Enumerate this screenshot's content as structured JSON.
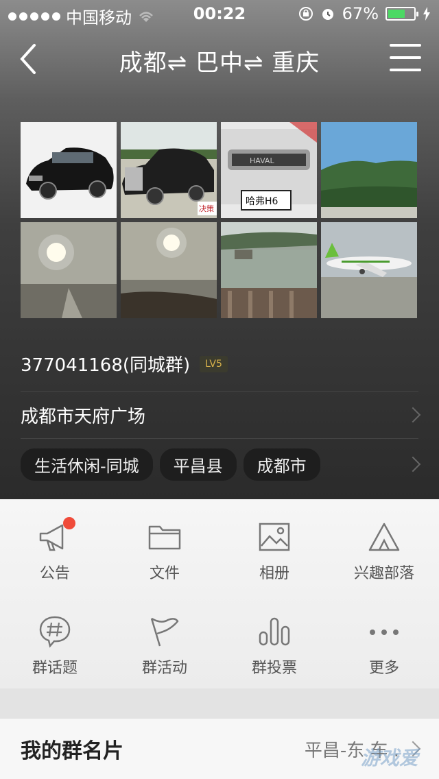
{
  "status": {
    "carrier": "中国移动",
    "time": "00:22",
    "battery_pct": "67%",
    "battery_level": 0.67,
    "battery_color": "#4cd964"
  },
  "nav": {
    "title": "成都⇌ 巴中⇌ 重庆",
    "back_icon": "chevron-left-icon",
    "menu_icon": "hamburger-icon"
  },
  "gallery": [
    {
      "name": "photo-black-sedan"
    },
    {
      "name": "photo-limousine"
    },
    {
      "name": "photo-haval-h6",
      "label": "哈弗H6"
    },
    {
      "name": "photo-mountain"
    },
    {
      "name": "photo-sunset-lake"
    },
    {
      "name": "photo-sunset-shore"
    },
    {
      "name": "photo-river-bridge"
    },
    {
      "name": "photo-airplane"
    }
  ],
  "group": {
    "id_text": "377041168(同城群)",
    "level": "LV5",
    "location": "成都市天府广场",
    "tags": [
      "生活休闲-同城",
      "平昌县",
      "成都市"
    ]
  },
  "functions": [
    {
      "label": "公告",
      "icon": "megaphone-icon",
      "badge": true
    },
    {
      "label": "文件",
      "icon": "folder-icon"
    },
    {
      "label": "相册",
      "icon": "photo-album-icon"
    },
    {
      "label": "兴趣部落",
      "icon": "tent-icon"
    },
    {
      "label": "群话题",
      "icon": "hashtag-bubble-icon"
    },
    {
      "label": "群活动",
      "icon": "flag-icon"
    },
    {
      "label": "群投票",
      "icon": "bar-chart-icon"
    },
    {
      "label": "更多",
      "icon": "more-dots-icon"
    }
  ],
  "card": {
    "title": "我的群名片",
    "value": "平昌-东 车 ."
  },
  "watermark": "游戏爱"
}
